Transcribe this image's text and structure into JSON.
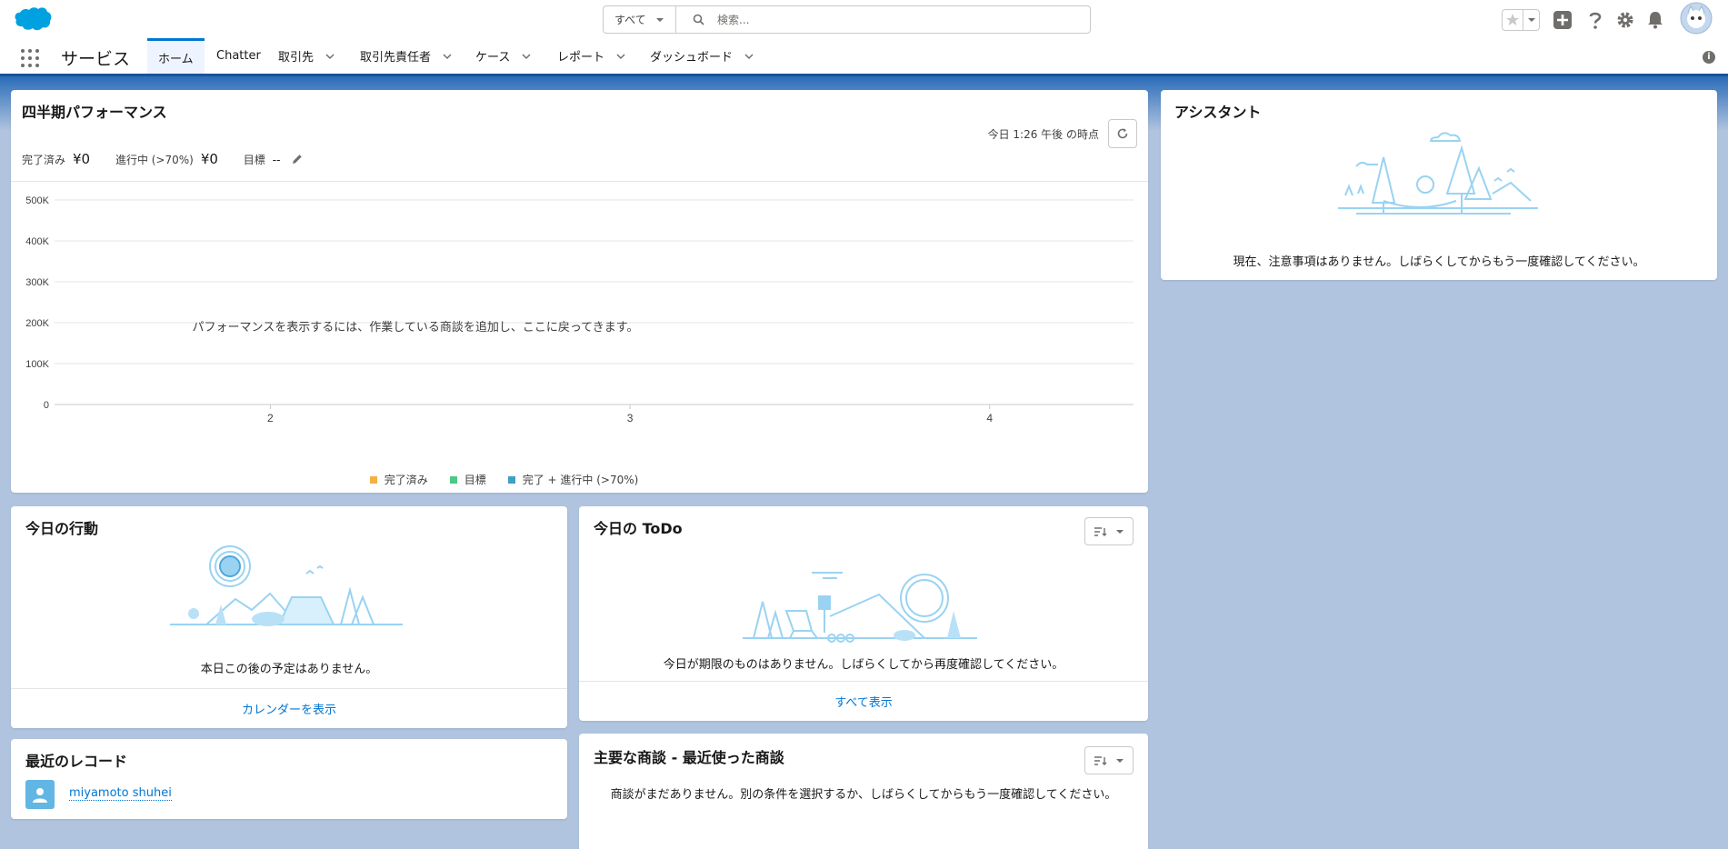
{
  "header": {
    "search_scope": "すべて",
    "search_placeholder": "検索..."
  },
  "nav": {
    "app_name": "サービス",
    "tabs": [
      {
        "label": "ホーム"
      },
      {
        "label": "Chatter"
      },
      {
        "label": "取引先"
      },
      {
        "label": "取引先責任者"
      },
      {
        "label": "ケース"
      },
      {
        "label": "レポート"
      },
      {
        "label": "ダッシュボード"
      }
    ]
  },
  "performance": {
    "title": "四半期パフォーマンス",
    "as_of": "今日 1:26 午後 の時点",
    "closed_label": "完了済み",
    "closed_value": "¥0",
    "open_label": "進行中 (>70%)",
    "open_value": "¥0",
    "goal_label": "目標",
    "goal_value": "--",
    "empty_message": "パフォーマンスを表示するには、作業している商談を追加し、ここに戻ってきます。"
  },
  "chart_data": {
    "type": "line",
    "x": [
      2,
      3,
      4
    ],
    "x_tick_labels": [
      "2",
      "3",
      "4"
    ],
    "y_tick_labels": [
      "500K",
      "400K",
      "300K",
      "200K",
      "100K",
      "0"
    ],
    "ylim": [
      0,
      500000
    ],
    "grid": true,
    "series": [
      {
        "name": "完了済み",
        "color": "#f5b044",
        "values": []
      },
      {
        "name": "目標",
        "color": "#4bca81",
        "values": []
      },
      {
        "name": "完了 + 進行中 (>70%)",
        "color": "#3ea0c8",
        "values": []
      }
    ],
    "legend_position": "bottom"
  },
  "assistant": {
    "title": "アシスタント",
    "message": "現在、注意事項はありません。しばらくしてからもう一度確認してください。"
  },
  "events": {
    "title": "今日の行動",
    "message": "本日この後の予定はありません。",
    "footer_link": "カレンダーを表示"
  },
  "todo": {
    "title": "今日の ToDo",
    "message": "今日が期限のものはありません。しばらくしてから再度確認してください。",
    "footer_link": "すべて表示"
  },
  "recent": {
    "title": "最近のレコード",
    "items": [
      {
        "name": "miyamoto shuhei"
      }
    ]
  },
  "deals": {
    "title": "主要な商談 - 最近使った商談",
    "message": "商談がまだありません。別の条件を選択するか、しばらくしてからもう一度確認してください。"
  }
}
